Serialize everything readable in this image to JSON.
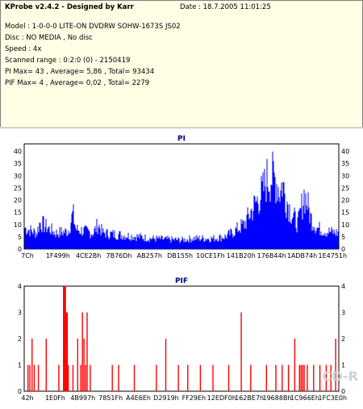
{
  "header": {
    "title": "KProbe v2.4.2 - Designed by Karr",
    "date": "Date : 18.7.2005 11:01:25",
    "lines": [
      "Model : 1-0-0-0 LITE-ON DVDRW SOHW-1673S JS02",
      "Disc : NO MEDIA , No disc",
      "Speed : 4x",
      "Scanned range : 0:2:0 (0) - 2150419",
      "PI Max= 43 , Average= 5,86 , Total= 93434",
      "PIF Max= 4 , Average= 0,02 , Total= 2279"
    ]
  },
  "colors": {
    "pi": "#0000ff",
    "pif": "#ff0000",
    "title": "#00008b",
    "plot_bg": "#ffffff"
  },
  "chart_data": [
    {
      "type": "area",
      "title": "PI",
      "ylim": [
        0,
        43
      ],
      "yticks": [
        0,
        5,
        10,
        15,
        20,
        25,
        30,
        35,
        40
      ],
      "x_ticks": [
        "7Ch",
        "1F499h",
        "4CE2Bh",
        "7B76Dh",
        "AB257h",
        "DB155h",
        "10CE1Fh",
        "141B20h",
        "176B44h",
        "1ADB74h",
        "1E4751h"
      ],
      "grid": false,
      "envelope": [
        [
          0,
          12
        ],
        [
          0.04,
          9
        ],
        [
          0.05,
          15
        ],
        [
          0.1,
          9
        ],
        [
          0.14,
          10
        ],
        [
          0.155,
          20
        ],
        [
          0.165,
          11
        ],
        [
          0.22,
          9
        ],
        [
          0.22,
          9
        ],
        [
          0.235,
          14
        ],
        [
          0.25,
          9
        ],
        [
          0.3,
          8
        ],
        [
          0.36,
          7
        ],
        [
          0.4,
          6
        ],
        [
          0.5,
          5
        ],
        [
          0.54,
          6
        ],
        [
          0.6,
          6
        ],
        [
          0.64,
          7
        ],
        [
          0.66,
          9
        ],
        [
          0.7,
          14
        ],
        [
          0.73,
          24
        ],
        [
          0.76,
          33
        ],
        [
          0.77,
          39
        ],
        [
          0.785,
          41
        ],
        [
          0.8,
          39
        ],
        [
          0.815,
          32
        ],
        [
          0.82,
          38
        ],
        [
          0.83,
          30
        ],
        [
          0.85,
          20
        ],
        [
          0.87,
          14
        ],
        [
          0.88,
          22
        ],
        [
          0.89,
          31
        ],
        [
          0.9,
          26
        ],
        [
          0.91,
          18
        ],
        [
          0.93,
          12
        ],
        [
          0.96,
          10
        ],
        [
          1,
          9
        ]
      ]
    },
    {
      "type": "bar",
      "title": "PIF",
      "ylim": [
        0,
        4
      ],
      "yticks": [
        0,
        1,
        2,
        3,
        4
      ],
      "x_ticks": [
        "42h",
        "1E0Fh",
        "4B997h",
        "7851Fh",
        "A4E6Eh",
        "D2919h",
        "FF29Eh",
        "12EDF0h",
        "162BE7h",
        "19688Bh",
        "1C966Eh",
        "1FC3E0h"
      ],
      "grid": false,
      "spikes": [
        [
          0.012,
          1
        ],
        [
          0.018,
          1
        ],
        [
          0.025,
          2
        ],
        [
          0.032,
          1
        ],
        [
          0.045,
          1
        ],
        [
          0.07,
          2
        ],
        [
          0.11,
          1
        ],
        [
          0.125,
          4
        ],
        [
          0.128,
          4
        ],
        [
          0.131,
          4
        ],
        [
          0.134,
          3
        ],
        [
          0.137,
          3
        ],
        [
          0.14,
          1
        ],
        [
          0.155,
          1
        ],
        [
          0.17,
          2
        ],
        [
          0.18,
          1
        ],
        [
          0.185,
          3
        ],
        [
          0.19,
          2
        ],
        [
          0.195,
          1
        ],
        [
          0.2,
          3
        ],
        [
          0.21,
          1
        ],
        [
          0.28,
          1
        ],
        [
          0.3,
          1
        ],
        [
          0.35,
          1
        ],
        [
          0.42,
          1
        ],
        [
          0.45,
          2
        ],
        [
          0.49,
          1
        ],
        [
          0.52,
          1
        ],
        [
          0.56,
          1
        ],
        [
          0.6,
          1
        ],
        [
          0.65,
          1
        ],
        [
          0.69,
          3
        ],
        [
          0.72,
          1
        ],
        [
          0.77,
          1
        ],
        [
          0.8,
          1
        ],
        [
          0.82,
          1
        ],
        [
          0.84,
          1
        ],
        [
          0.86,
          2
        ],
        [
          0.875,
          1
        ],
        [
          0.88,
          1
        ],
        [
          0.885,
          1
        ],
        [
          0.89,
          1
        ],
        [
          0.9,
          1
        ],
        [
          0.92,
          1
        ],
        [
          0.94,
          1
        ],
        [
          0.96,
          1
        ],
        [
          0.975,
          1
        ],
        [
          0.99,
          2
        ]
      ]
    }
  ]
}
